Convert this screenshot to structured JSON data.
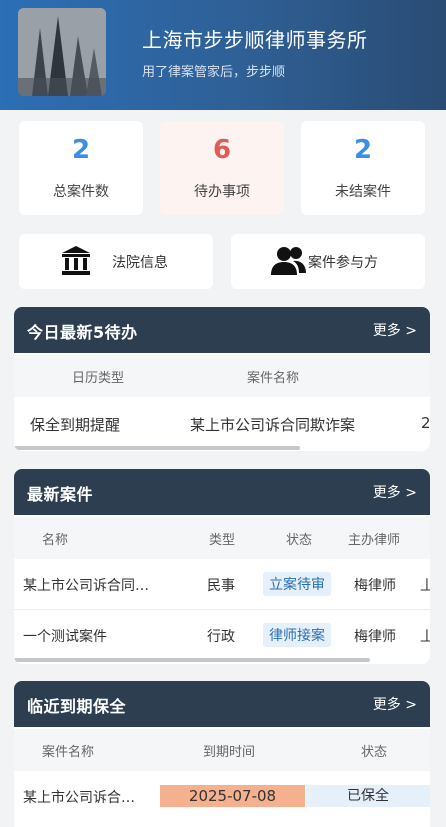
{
  "header": {
    "firm_name": "上海市步步顺律师事务所",
    "slogan": "用了律案管家后，步步顺"
  },
  "stats": [
    {
      "value": "2",
      "label": "总案件数"
    },
    {
      "value": "6",
      "label": "待办事项"
    },
    {
      "value": "2",
      "label": "未结案件"
    }
  ],
  "quick_links": [
    {
      "label": "法院信息",
      "icon": "courthouse-icon"
    },
    {
      "label": "案件参与方",
      "icon": "people-icon"
    }
  ],
  "todo": {
    "title": "今日最新5待办",
    "more": "更多 >",
    "columns": [
      "日历类型",
      "案件名称"
    ],
    "rows": [
      {
        "type": "保全到期提醒",
        "case": "某上市公司诉合同欺诈案",
        "extra": "2"
      }
    ]
  },
  "cases": {
    "title": "最新案件",
    "more": "更多 >",
    "columns": [
      "名称",
      "类型",
      "状态",
      "主办律师"
    ],
    "rows": [
      {
        "name": "某上市公司诉合同…",
        "type": "民事",
        "status": "立案待审",
        "lawyer": "梅律师",
        "extra": "丄"
      },
      {
        "name": "一个测试案件",
        "type": "行政",
        "status": "律师接案",
        "lawyer": "梅律师",
        "extra": "丄"
      }
    ]
  },
  "preservation": {
    "title": "临近到期保全",
    "more": "更多 >",
    "columns": [
      "案件名称",
      "到期时间",
      "状态"
    ],
    "rows": [
      {
        "name": "某上市公司诉合…",
        "due": "2025-07-08",
        "status": "已保全"
      }
    ]
  },
  "colors": {
    "header": "#2c6fb6",
    "card_head": "#2c3e50",
    "stat_blue": "#3a8ee6",
    "stat_red": "#e05d55",
    "due_highlight": "#f5b08f",
    "status_tag_bg": "#e5f0fb"
  }
}
